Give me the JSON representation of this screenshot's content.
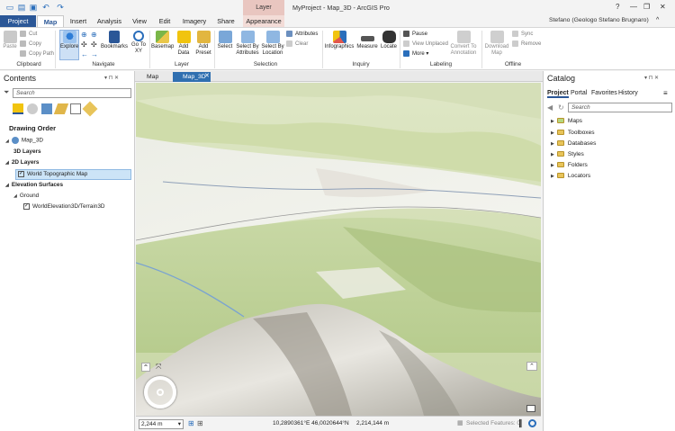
{
  "window": {
    "title": "MyProject - Map_3D - ArcGIS Pro",
    "context_group": "Layer",
    "user": "Stefano (Geologo Stefano Brugnaro)"
  },
  "tabs": [
    "Project",
    "Map",
    "Insert",
    "Analysis",
    "View",
    "Edit",
    "Imagery",
    "Share",
    "Appearance"
  ],
  "ribbon": {
    "clipboard": {
      "paste": "Paste",
      "cut": "Cut",
      "copy": "Copy",
      "copy_path": "Copy Path",
      "group": "Clipboard"
    },
    "navigate": {
      "explore": "Explore",
      "bookmarks": "Bookmarks",
      "go_to_xy": "Go To XY",
      "group": "Navigate"
    },
    "layer": {
      "basemap": "Basemap",
      "add_data": "Add Data",
      "add_preset": "Add Preset",
      "group": "Layer"
    },
    "selection": {
      "select": "Select",
      "select_by_attributes": "Select By Attributes",
      "select_by_location": "Select By Location",
      "attributes": "Attributes",
      "clear": "Clear",
      "group": "Selection"
    },
    "inquiry": {
      "infographics": "Infographics",
      "measure": "Measure",
      "locate": "Locate",
      "group": "Inquiry"
    },
    "labeling": {
      "pause": "Pause",
      "view_unplaced": "View Unplaced",
      "more": "More",
      "convert": "Convert To Annotation",
      "group": "Labeling"
    },
    "offline": {
      "download_map": "Download Map",
      "sync": "Sync",
      "remove": "Remove",
      "group": "Offline"
    }
  },
  "contents": {
    "title": "Contents",
    "search_placeholder": "Search",
    "drawing_order": "Drawing Order",
    "map_name": "Map_3D",
    "layers_3d": "3D Layers",
    "layers_2d": "2D Layers",
    "topo_layer": "World Topographic Map",
    "elevation": "Elevation Surfaces",
    "ground": "Ground",
    "terrain": "WorldElevation3D/Terrain3D"
  },
  "map_tabs": [
    "Map",
    "Map_3D"
  ],
  "status": {
    "scale": "2,244 m",
    "coords": "10,2890361°E 46,0020644°N",
    "elevation": "2,214,144 m",
    "selected": "Selected Features: 0"
  },
  "catalog": {
    "title": "Catalog",
    "tabs": [
      "Project",
      "Portal",
      "Favorites",
      "History"
    ],
    "search_placeholder": "Search",
    "items": [
      "Maps",
      "Toolboxes",
      "Databases",
      "Styles",
      "Folders",
      "Locators"
    ]
  },
  "colors": {
    "accent": "#2b5797",
    "active_tab": "#2f6fb0",
    "context": "#e9c6c0"
  }
}
